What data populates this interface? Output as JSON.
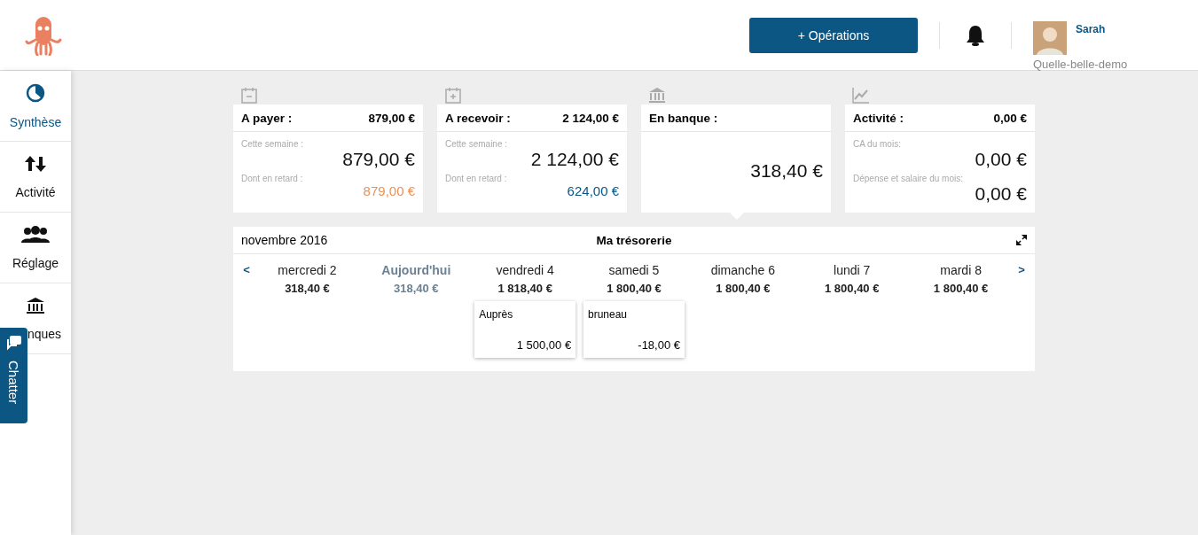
{
  "header": {
    "button": "+ Opérations",
    "user": {
      "name": "Sarah",
      "company": "Quelle-belle-demo"
    }
  },
  "sidebar": {
    "items": [
      {
        "label": "Synthèse",
        "selected": true
      },
      {
        "label": "Activité",
        "selected": false
      },
      {
        "label": "Réglage",
        "selected": false
      },
      {
        "label": "nques",
        "selected": false
      }
    ]
  },
  "chat_tab": {
    "label": "Chatter"
  },
  "cards": [
    {
      "title": "A payer :",
      "total": "879,00 €",
      "rows": [
        {
          "kind": "large",
          "label": "Cette semaine :",
          "value": "879,00 €"
        },
        {
          "kind": "small",
          "label": "Dont en retard :",
          "value": "879,00 €",
          "color": "#e9915b"
        }
      ]
    },
    {
      "title": "A recevoir :",
      "total": "2 124,00 €",
      "rows": [
        {
          "kind": "large",
          "label": "Cette semaine :",
          "value": "2 124,00 €"
        },
        {
          "kind": "small",
          "label": "Dont en retard :",
          "value": "624,00 €",
          "color": "#0b5683"
        }
      ]
    },
    {
      "title": "En banque :",
      "selected": true,
      "rows": [
        {
          "kind": "large",
          "value": "318,40 €"
        }
      ]
    },
    {
      "title": "Activité :",
      "total": "0,00 €",
      "rows": [
        {
          "kind": "large",
          "label": "CA du mois:",
          "value": "0,00 €"
        },
        {
          "kind": "large",
          "label": "Dépense et salaire du mois:",
          "value": "0,00 €"
        }
      ]
    }
  ],
  "treasury": {
    "month": "novembre 2016",
    "title": "Ma trésorerie",
    "prev": "<",
    "next": ">",
    "days": [
      {
        "label": "mercredi 2",
        "balance": "318,40 €",
        "selected": false
      },
      {
        "label": "Aujourd'hui",
        "balance": "318,40 €",
        "selected": true
      },
      {
        "label": "vendredi 4",
        "balance": "1 818,40 €",
        "selected": false,
        "events": [
          {
            "name": "Auprès",
            "amount": "1 500,00 €"
          }
        ]
      },
      {
        "label": "samedi 5",
        "balance": "1 800,40 €",
        "selected": false,
        "events": [
          {
            "name": "bruneau",
            "amount": "-18,00 €"
          }
        ]
      },
      {
        "label": "dimanche 6",
        "balance": "1 800,40 €",
        "selected": false
      },
      {
        "label": "lundi 7",
        "balance": "1 800,40 €",
        "selected": false
      },
      {
        "label": "mardi 8",
        "balance": "1 800,40 €",
        "selected": false
      }
    ]
  }
}
